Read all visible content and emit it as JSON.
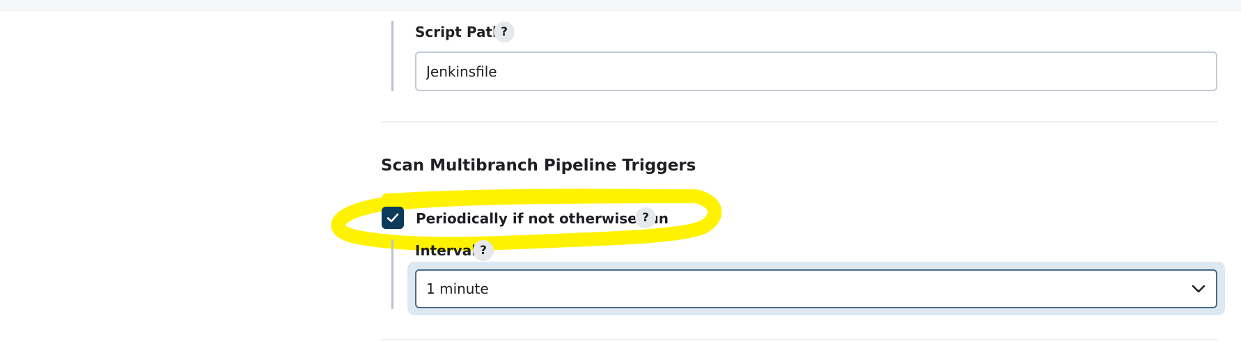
{
  "script_path": {
    "label": "Script Path",
    "help": "?",
    "value": "Jenkinsfile"
  },
  "triggers": {
    "section_title": "Scan Multibranch Pipeline Triggers",
    "periodic": {
      "label": "Periodically if not otherwise run",
      "help": "?",
      "checked": true
    },
    "interval": {
      "label": "Interval",
      "help": "?",
      "selected": "1 minute"
    }
  },
  "colors": {
    "checkbox": "#0b3a5b",
    "highlight": "#fff200",
    "select_focus_ring": "#dde8f1"
  }
}
